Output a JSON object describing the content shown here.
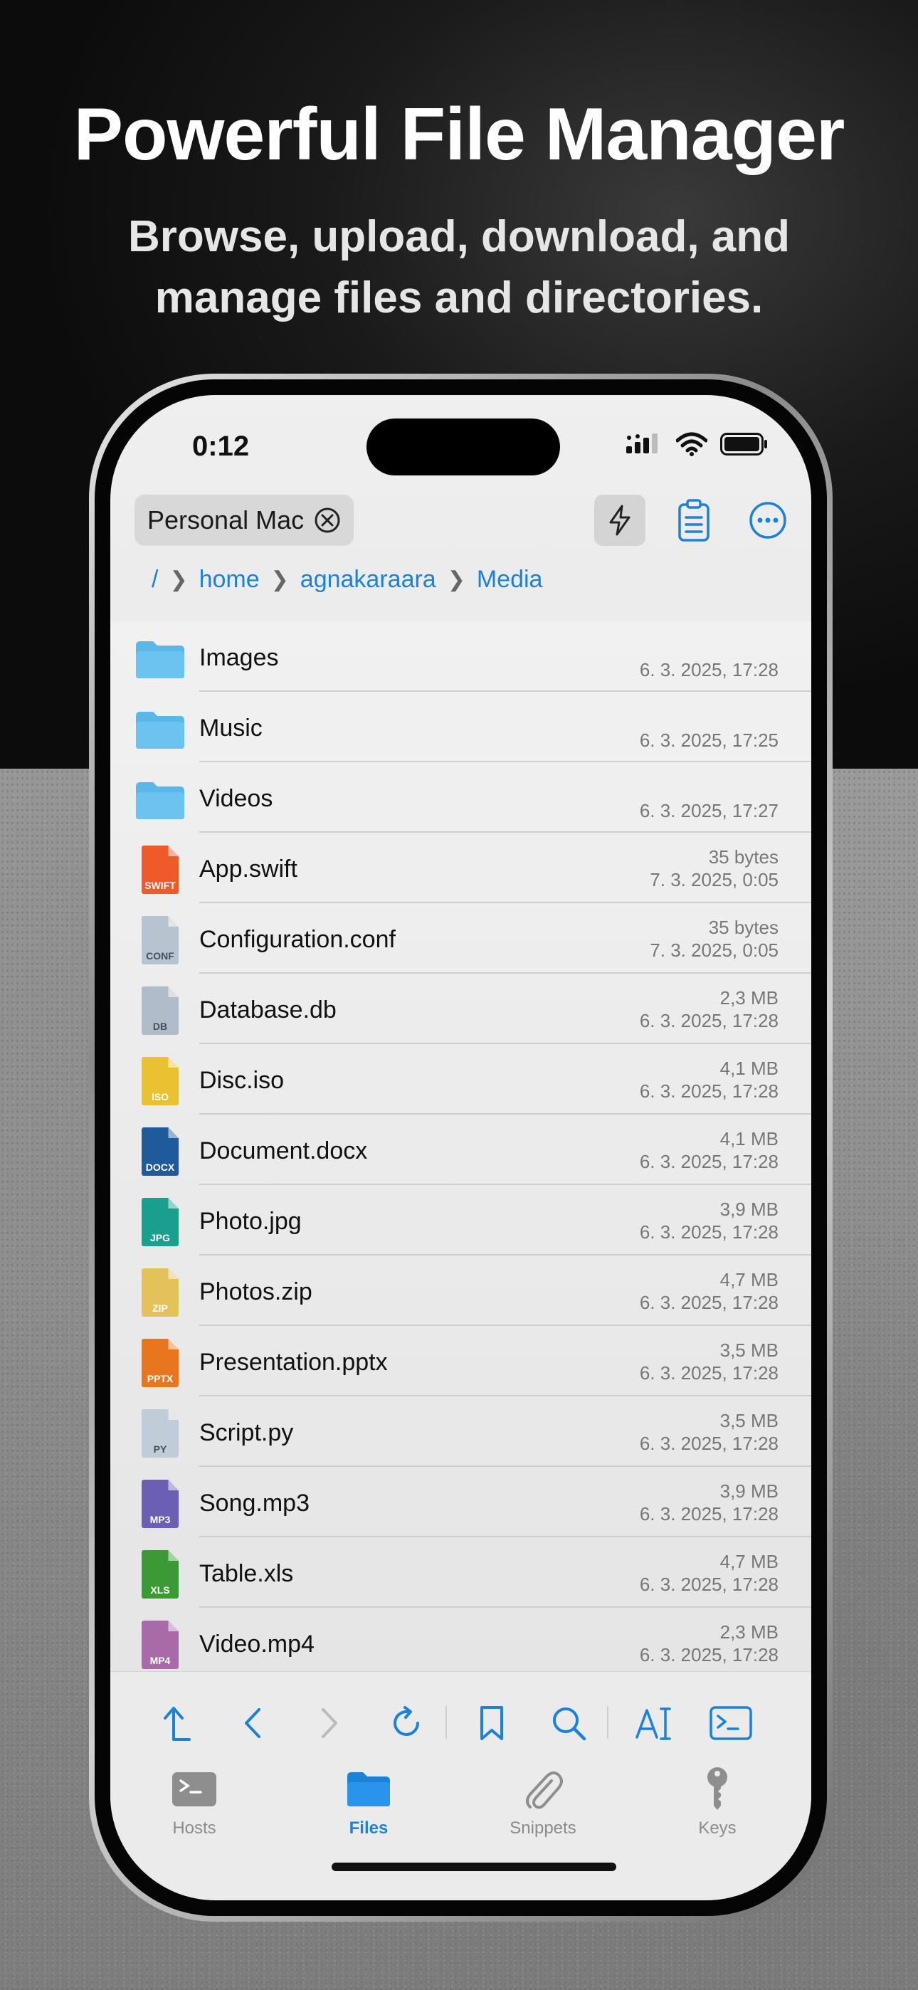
{
  "headline": {
    "title": "Powerful File Manager",
    "subtitle_line1": "Browse, upload, download, and",
    "subtitle_line2": "manage files and directories."
  },
  "status_bar": {
    "time": "0:12"
  },
  "top_toolbar": {
    "host_label": "Personal Mac",
    "icons": [
      "close-circle-icon",
      "bolt-icon",
      "clipboard-icon",
      "more-icon"
    ]
  },
  "breadcrumb": [
    "/",
    "home",
    "agnakaraara",
    "Media"
  ],
  "files": [
    {
      "name": "Images",
      "size": "",
      "date": "6. 3. 2025, 17:28",
      "type": "folder"
    },
    {
      "name": "Music",
      "size": "",
      "date": "6. 3. 2025, 17:25",
      "type": "folder"
    },
    {
      "name": "Videos",
      "size": "",
      "date": "6. 3. 2025, 17:27",
      "type": "folder"
    },
    {
      "name": "App.swift",
      "size": "35 bytes",
      "date": "7. 3. 2025, 0:05",
      "type": "file",
      "ext": "SWIFT",
      "color": "#ef5a2a"
    },
    {
      "name": "Configuration.conf",
      "size": "35 bytes",
      "date": "7. 3. 2025, 0:05",
      "type": "file",
      "ext": "CONF",
      "color": "#b7c3cf"
    },
    {
      "name": "Database.db",
      "size": "2,3 MB",
      "date": "6. 3. 2025, 17:28",
      "type": "file",
      "ext": "DB",
      "color": "#b0bcc8"
    },
    {
      "name": "Disc.iso",
      "size": "4,1 MB",
      "date": "6. 3. 2025, 17:28",
      "type": "file",
      "ext": "ISO",
      "color": "#e8c230"
    },
    {
      "name": "Document.docx",
      "size": "4,1 MB",
      "date": "6. 3. 2025, 17:28",
      "type": "file",
      "ext": "DOCX",
      "color": "#1f5a9a"
    },
    {
      "name": "Photo.jpg",
      "size": "3,9 MB",
      "date": "6. 3. 2025, 17:28",
      "type": "file",
      "ext": "JPG",
      "color": "#1a9e8e"
    },
    {
      "name": "Photos.zip",
      "size": "4,7 MB",
      "date": "6. 3. 2025, 17:28",
      "type": "file",
      "ext": "ZIP",
      "color": "#e4c25a"
    },
    {
      "name": "Presentation.pptx",
      "size": "3,5 MB",
      "date": "6. 3. 2025, 17:28",
      "type": "file",
      "ext": "PPTX",
      "color": "#e8761e"
    },
    {
      "name": "Script.py",
      "size": "3,5 MB",
      "date": "6. 3. 2025, 17:28",
      "type": "file",
      "ext": "PY",
      "color": "#c0ccd8"
    },
    {
      "name": "Song.mp3",
      "size": "3,9 MB",
      "date": "6. 3. 2025, 17:28",
      "type": "file",
      "ext": "MP3",
      "color": "#6a5fb2"
    },
    {
      "name": "Table.xls",
      "size": "4,7 MB",
      "date": "6. 3. 2025, 17:28",
      "type": "file",
      "ext": "XLS",
      "color": "#3c9a36"
    },
    {
      "name": "Video.mp4",
      "size": "2,3 MB",
      "date": "6. 3. 2025, 17:28",
      "type": "file",
      "ext": "MP4",
      "color": "#a86aa8"
    }
  ],
  "bottom_toolbar": {
    "tools": [
      "up-arrow-icon",
      "back-icon",
      "forward-icon",
      "refresh-icon",
      "bookmark-icon",
      "search-icon",
      "text-size-icon",
      "terminal-icon"
    ]
  },
  "tabs": [
    {
      "label": "Hosts",
      "icon": "terminal-window-icon",
      "active": false
    },
    {
      "label": "Files",
      "icon": "folder-icon",
      "active": true
    },
    {
      "label": "Snippets",
      "icon": "paperclip-icon",
      "active": false
    },
    {
      "label": "Keys",
      "icon": "key-icon",
      "active": false
    }
  ],
  "colors": {
    "accent": "#1b82d8",
    "folder": "#5ab7ea"
  }
}
